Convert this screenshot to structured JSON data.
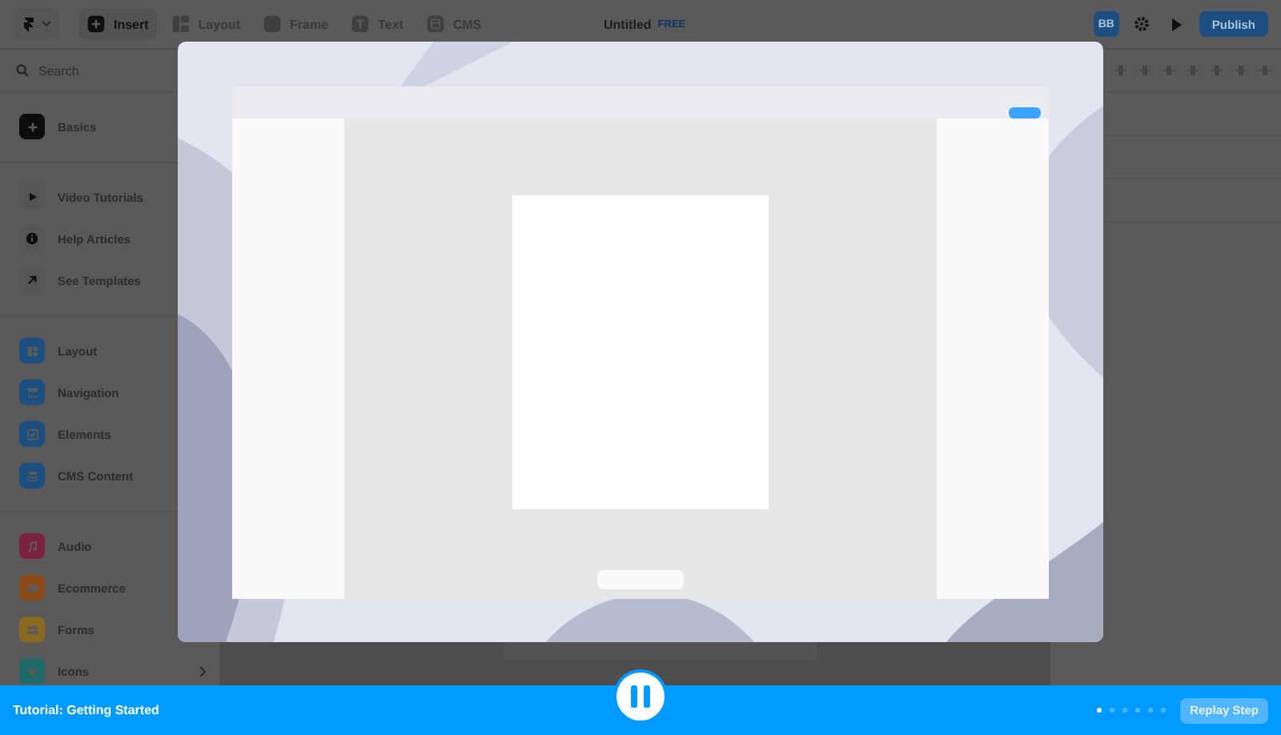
{
  "toolbar": {
    "tools": [
      {
        "label": "Insert",
        "selected": true
      },
      {
        "label": "Layout",
        "selected": false
      },
      {
        "label": "Frame",
        "selected": false
      },
      {
        "label": "Text",
        "selected": false
      },
      {
        "label": "CMS",
        "selected": false
      }
    ],
    "title": "Untitled",
    "plan_badge": "FREE",
    "avatar": "BB",
    "publish": "Publish"
  },
  "sidebar": {
    "search": {
      "placeholder": "Search"
    },
    "groups": [
      [
        {
          "label": "Basics",
          "kind": "tile",
          "color": "#0d0d0d"
        }
      ],
      [
        {
          "label": "Video Tutorials",
          "kind": "plain"
        },
        {
          "label": "Help Articles",
          "kind": "plain"
        },
        {
          "label": "See Templates",
          "kind": "plain"
        }
      ],
      [
        {
          "label": "Layout",
          "kind": "tile",
          "color": "#1c4f80"
        },
        {
          "label": "Navigation",
          "kind": "tile",
          "color": "#1c4f80"
        },
        {
          "label": "Elements",
          "kind": "tile",
          "color": "#1c4f80"
        },
        {
          "label": "CMS Content",
          "kind": "tile",
          "color": "#1c4f80"
        }
      ],
      [
        {
          "label": "Audio",
          "kind": "tile",
          "color": "#7a2340"
        },
        {
          "label": "Ecommerce",
          "kind": "tile",
          "color": "#8a4a1a"
        },
        {
          "label": "Forms",
          "kind": "tile",
          "color": "#8a6a1e"
        },
        {
          "label": "Icons",
          "kind": "tile",
          "color": "#1f6a66",
          "submenu": true
        }
      ]
    ]
  },
  "tutorial": {
    "kind": "picture",
    "title": "Tutorial: Getting Started",
    "playing": true,
    "steps": [
      {
        "selected": true
      },
      {
        "selected": false
      },
      {
        "selected": false
      },
      {
        "selected": false
      },
      {
        "selected": false
      },
      {
        "selected": false
      }
    ],
    "replay": "Replay Step"
  }
}
